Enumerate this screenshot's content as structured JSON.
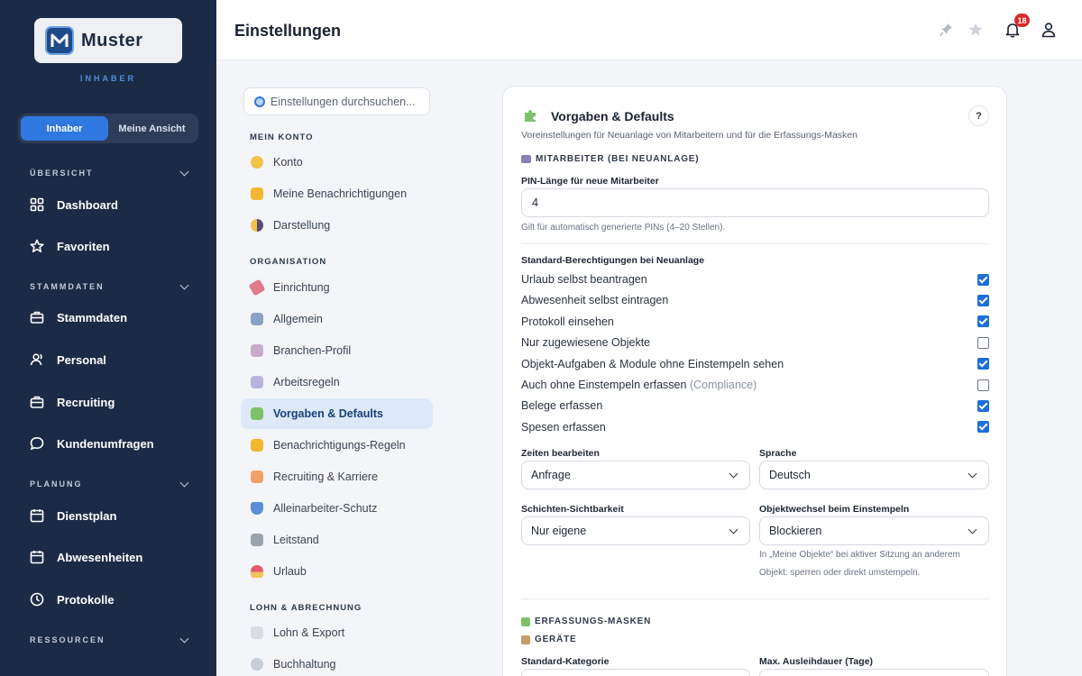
{
  "sidebar": {
    "brand": "Muster",
    "role": "INHABER",
    "toggle": [
      "Inhaber",
      "Meine Ansicht"
    ],
    "sections": [
      "ÜBERSICHT",
      "STAMMDATEN",
      "PLANUNG",
      "RESSOURCEN"
    ],
    "items": [
      "Dashboard",
      "Favoriten",
      "Stammdaten",
      "Personal",
      "Recruiting",
      "Kundenumfragen",
      "Dienstplan",
      "Abwesenheiten",
      "Protokolle"
    ]
  },
  "header": {
    "title": "Einstellungen",
    "notification_count": "18"
  },
  "settings_nav": {
    "search_placeholder": "Einstellungen durchsuchen...",
    "sections": [
      "MEIN KONTO",
      "ORGANISATION",
      "LOHN & ABRECHNUNG"
    ],
    "items": [
      "Konto",
      "Meine Benachrichtigungen",
      "Darstellung",
      "Einrichtung",
      "Allgemein",
      "Branchen-Profil",
      "Arbeitsregeln",
      "Vorgaben & Defaults",
      "Benachrichtigungs-Regeln",
      "Recruiting & Karriere",
      "Alleinarbeiter-Schutz",
      "Leitstand",
      "Urlaub",
      "Lohn & Export",
      "Buchhaltung"
    ]
  },
  "card": {
    "title": "Vorgaben & Defaults",
    "help": "?",
    "description": "Voreinstellungen für Neuanlage von Mitarbeitern und für die Erfassungs-Masken",
    "employees_heading": "MITARBEITER (BEI NEUANLAGE)",
    "pin_label": "PIN-Länge für neue Mitarbeiter",
    "pin_value": "4",
    "pin_hint": "Gilt für automatisch generierte PINs (4–20 Stellen).",
    "perm_heading": "Standard-Berechtigungen bei Neuanlage",
    "permissions": [
      {
        "label": "Urlaub selbst beantragen",
        "note": "",
        "checked": true
      },
      {
        "label": "Abwesenheit selbst eintragen",
        "note": "",
        "checked": true
      },
      {
        "label": "Protokoll einsehen",
        "note": "",
        "checked": true
      },
      {
        "label": "Nur zugewiesene Objekte",
        "note": "",
        "checked": false
      },
      {
        "label": "Objekt-Aufgaben & Module ohne Einstempeln sehen",
        "note": "",
        "checked": true
      },
      {
        "label": "Auch ohne Einstempeln erfassen",
        "note": "(Compliance)",
        "checked": false
      },
      {
        "label": "Belege erfassen",
        "note": "",
        "checked": true
      },
      {
        "label": "Spesen erfassen",
        "note": "",
        "checked": true
      }
    ],
    "times_label": "Zeiten bearbeiten",
    "times_value": "Anfrage",
    "language_label": "Sprache",
    "language_value": "Deutsch",
    "shift_label": "Schichten-Sichtbarkeit",
    "shift_value": "Nur eigene",
    "objswitch_label": "Objektwechsel beim Einstempeln",
    "objswitch_value": "Blockieren",
    "objswitch_hint_1": "In „Meine Objekte“ bei aktiver Sitzung an anderem",
    "objswitch_hint_2": "Objekt: sperren oder direkt umstempeln.",
    "masks_heading": "ERFASSUNGS-MASKEN",
    "devices_heading": "GERÄTE",
    "default_category_label": "Standard-Kategorie",
    "max_loan_label": "Max. Ausleihdauer (Tage)"
  },
  "colors": {
    "sidebar": "#1c2b45",
    "accent": "#2f78e0",
    "active_nav": "#dde9f8",
    "badge": "#d92c2c"
  }
}
